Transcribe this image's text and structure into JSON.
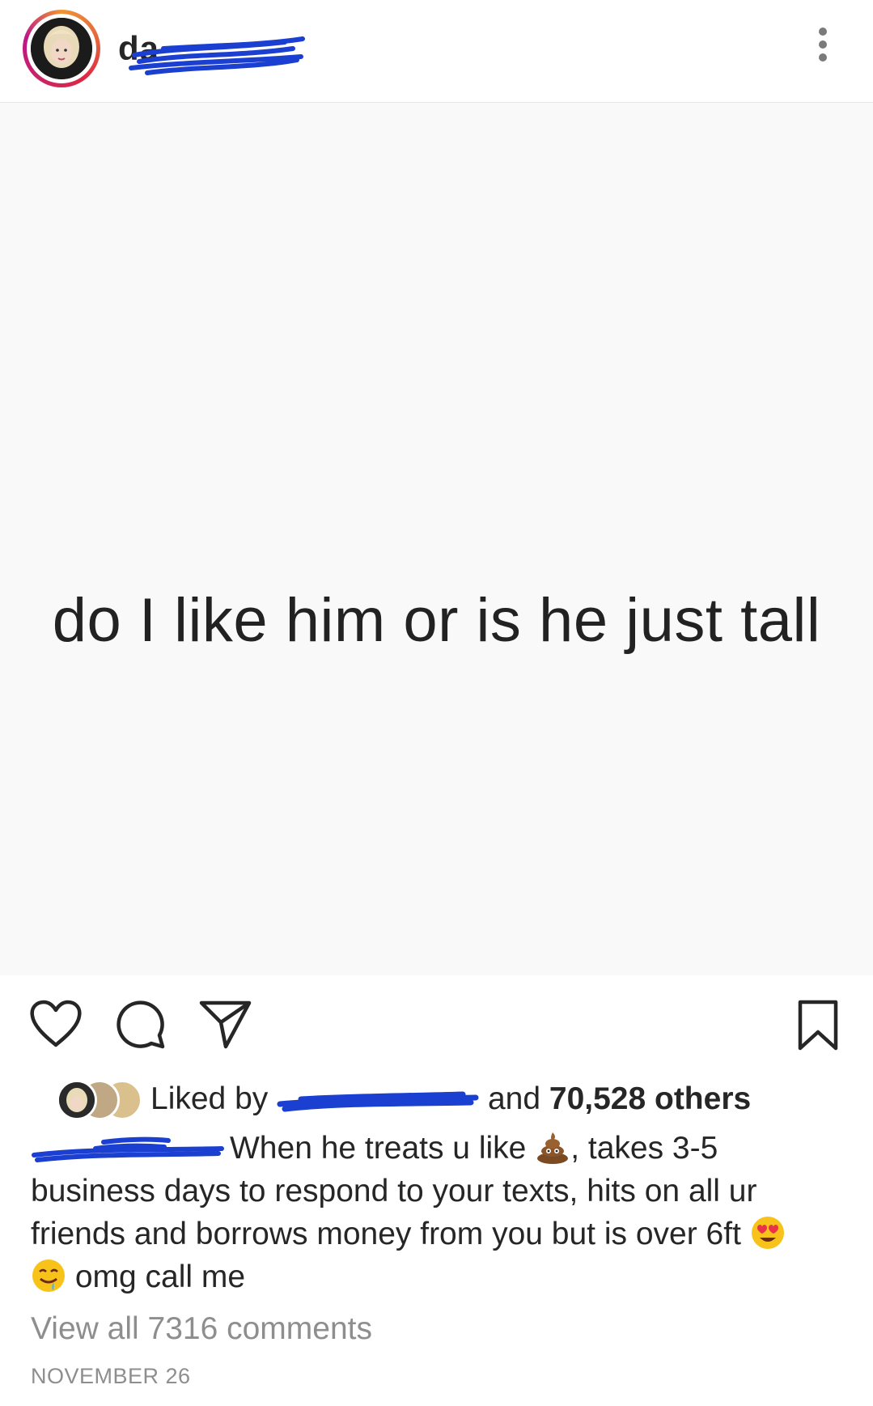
{
  "header": {
    "username_visible": "da",
    "more_icon": "more-vertical-icon"
  },
  "post": {
    "image_text": "do I like him or is he just tall"
  },
  "actions": {
    "like_icon": "heart-icon",
    "comment_icon": "comment-icon",
    "share_icon": "send-icon",
    "save_icon": "bookmark-icon"
  },
  "likes": {
    "prefix": "Liked by",
    "middle": "and",
    "count": "70,528 others"
  },
  "caption": {
    "text_part1": "When he treats u like",
    "text_part2": ", takes 3-5 business days to respond to your texts, hits on all ur friends and borrows money from you but is over 6ft",
    "text_part3": "omg call me"
  },
  "comments": {
    "view_all": "View all 7316 comments"
  },
  "date": "NOVEMBER 26",
  "colors": {
    "scribble": "#1a3fd1",
    "heart_eyes": "#e8334a",
    "emoji_yellow": "#f7c21a",
    "poop": "#7a4a22"
  }
}
